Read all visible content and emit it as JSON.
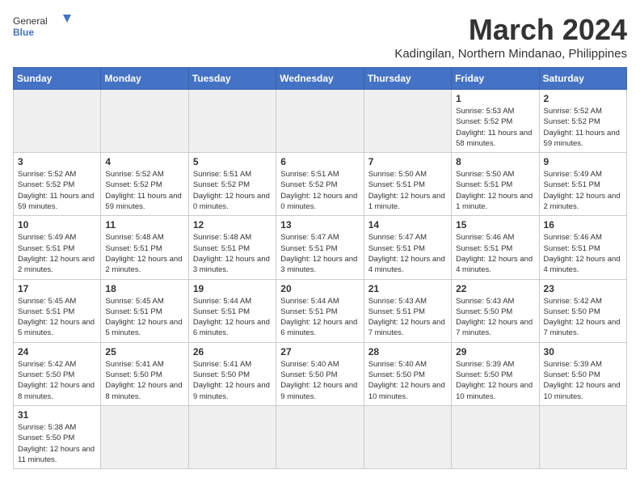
{
  "logo": {
    "text_general": "General",
    "text_blue": "Blue"
  },
  "title": "March 2024",
  "location": "Kadingilan, Northern Mindanao, Philippines",
  "days_of_week": [
    "Sunday",
    "Monday",
    "Tuesday",
    "Wednesday",
    "Thursday",
    "Friday",
    "Saturday"
  ],
  "weeks": [
    [
      {
        "day": "",
        "info": ""
      },
      {
        "day": "",
        "info": ""
      },
      {
        "day": "",
        "info": ""
      },
      {
        "day": "",
        "info": ""
      },
      {
        "day": "",
        "info": ""
      },
      {
        "day": "1",
        "info": "Sunrise: 5:53 AM\nSunset: 5:52 PM\nDaylight: 11 hours and 58 minutes."
      },
      {
        "day": "2",
        "info": "Sunrise: 5:52 AM\nSunset: 5:52 PM\nDaylight: 11 hours and 59 minutes."
      }
    ],
    [
      {
        "day": "3",
        "info": "Sunrise: 5:52 AM\nSunset: 5:52 PM\nDaylight: 11 hours and 59 minutes."
      },
      {
        "day": "4",
        "info": "Sunrise: 5:52 AM\nSunset: 5:52 PM\nDaylight: 11 hours and 59 minutes."
      },
      {
        "day": "5",
        "info": "Sunrise: 5:51 AM\nSunset: 5:52 PM\nDaylight: 12 hours and 0 minutes."
      },
      {
        "day": "6",
        "info": "Sunrise: 5:51 AM\nSunset: 5:52 PM\nDaylight: 12 hours and 0 minutes."
      },
      {
        "day": "7",
        "info": "Sunrise: 5:50 AM\nSunset: 5:51 PM\nDaylight: 12 hours and 1 minute."
      },
      {
        "day": "8",
        "info": "Sunrise: 5:50 AM\nSunset: 5:51 PM\nDaylight: 12 hours and 1 minute."
      },
      {
        "day": "9",
        "info": "Sunrise: 5:49 AM\nSunset: 5:51 PM\nDaylight: 12 hours and 2 minutes."
      }
    ],
    [
      {
        "day": "10",
        "info": "Sunrise: 5:49 AM\nSunset: 5:51 PM\nDaylight: 12 hours and 2 minutes."
      },
      {
        "day": "11",
        "info": "Sunrise: 5:48 AM\nSunset: 5:51 PM\nDaylight: 12 hours and 2 minutes."
      },
      {
        "day": "12",
        "info": "Sunrise: 5:48 AM\nSunset: 5:51 PM\nDaylight: 12 hours and 3 minutes."
      },
      {
        "day": "13",
        "info": "Sunrise: 5:47 AM\nSunset: 5:51 PM\nDaylight: 12 hours and 3 minutes."
      },
      {
        "day": "14",
        "info": "Sunrise: 5:47 AM\nSunset: 5:51 PM\nDaylight: 12 hours and 4 minutes."
      },
      {
        "day": "15",
        "info": "Sunrise: 5:46 AM\nSunset: 5:51 PM\nDaylight: 12 hours and 4 minutes."
      },
      {
        "day": "16",
        "info": "Sunrise: 5:46 AM\nSunset: 5:51 PM\nDaylight: 12 hours and 4 minutes."
      }
    ],
    [
      {
        "day": "17",
        "info": "Sunrise: 5:45 AM\nSunset: 5:51 PM\nDaylight: 12 hours and 5 minutes."
      },
      {
        "day": "18",
        "info": "Sunrise: 5:45 AM\nSunset: 5:51 PM\nDaylight: 12 hours and 5 minutes."
      },
      {
        "day": "19",
        "info": "Sunrise: 5:44 AM\nSunset: 5:51 PM\nDaylight: 12 hours and 6 minutes."
      },
      {
        "day": "20",
        "info": "Sunrise: 5:44 AM\nSunset: 5:51 PM\nDaylight: 12 hours and 6 minutes."
      },
      {
        "day": "21",
        "info": "Sunrise: 5:43 AM\nSunset: 5:51 PM\nDaylight: 12 hours and 7 minutes."
      },
      {
        "day": "22",
        "info": "Sunrise: 5:43 AM\nSunset: 5:50 PM\nDaylight: 12 hours and 7 minutes."
      },
      {
        "day": "23",
        "info": "Sunrise: 5:42 AM\nSunset: 5:50 PM\nDaylight: 12 hours and 7 minutes."
      }
    ],
    [
      {
        "day": "24",
        "info": "Sunrise: 5:42 AM\nSunset: 5:50 PM\nDaylight: 12 hours and 8 minutes."
      },
      {
        "day": "25",
        "info": "Sunrise: 5:41 AM\nSunset: 5:50 PM\nDaylight: 12 hours and 8 minutes."
      },
      {
        "day": "26",
        "info": "Sunrise: 5:41 AM\nSunset: 5:50 PM\nDaylight: 12 hours and 9 minutes."
      },
      {
        "day": "27",
        "info": "Sunrise: 5:40 AM\nSunset: 5:50 PM\nDaylight: 12 hours and 9 minutes."
      },
      {
        "day": "28",
        "info": "Sunrise: 5:40 AM\nSunset: 5:50 PM\nDaylight: 12 hours and 10 minutes."
      },
      {
        "day": "29",
        "info": "Sunrise: 5:39 AM\nSunset: 5:50 PM\nDaylight: 12 hours and 10 minutes."
      },
      {
        "day": "30",
        "info": "Sunrise: 5:39 AM\nSunset: 5:50 PM\nDaylight: 12 hours and 10 minutes."
      }
    ],
    [
      {
        "day": "31",
        "info": "Sunrise: 5:38 AM\nSunset: 5:50 PM\nDaylight: 12 hours and 11 minutes."
      },
      {
        "day": "",
        "info": ""
      },
      {
        "day": "",
        "info": ""
      },
      {
        "day": "",
        "info": ""
      },
      {
        "day": "",
        "info": ""
      },
      {
        "day": "",
        "info": ""
      },
      {
        "day": "",
        "info": ""
      }
    ]
  ]
}
